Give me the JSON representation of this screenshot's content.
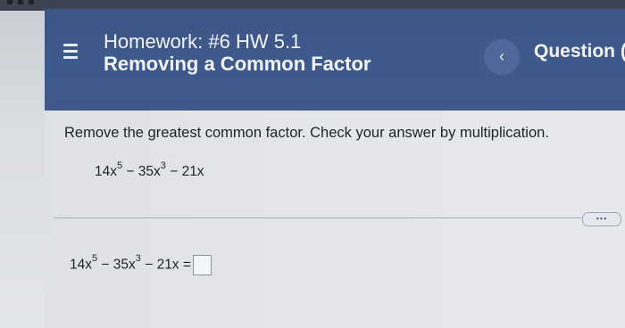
{
  "header": {
    "title": "Homework: #6 HW 5.1",
    "subtitle": "Removing a Common Factor",
    "back_glyph": "‹",
    "question_label": "Question",
    "question_partial": "("
  },
  "problem": {
    "instruction": "Remove the greatest common factor. Check your answer by multiplication.",
    "expression": {
      "t1_coef": "14x",
      "t1_exp": "5",
      "t2_sep": " − 35x",
      "t2_exp": "3",
      "t3": " − 21x"
    },
    "more_label": "•••",
    "answer": {
      "equals": " =",
      "value": ""
    }
  },
  "icons": {
    "menu": "hamburger-menu-icon",
    "back": "chevron-left-icon",
    "more": "ellipsis-icon"
  },
  "colors": {
    "header_bg": "#3e5a8d",
    "content_bg": "#e4e6e9",
    "text": "#1f2326"
  }
}
